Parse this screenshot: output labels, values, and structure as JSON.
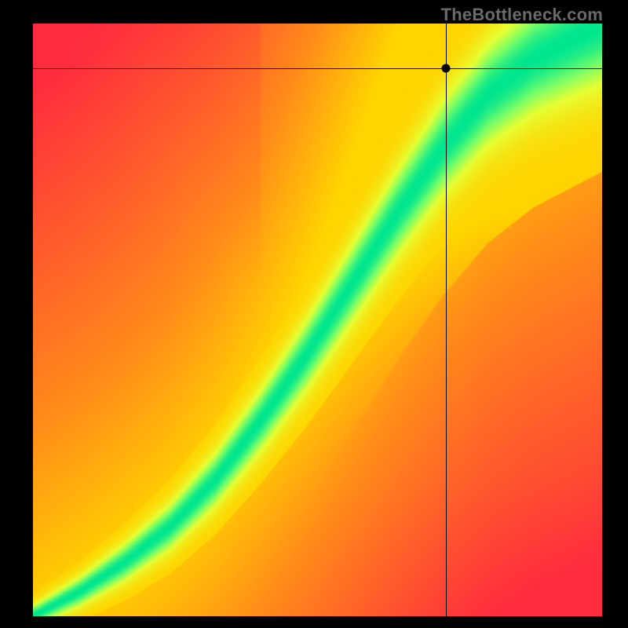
{
  "watermark": "TheBottleneck.com",
  "chart_data": {
    "type": "heatmap",
    "title": "",
    "xlabel": "",
    "ylabel": "",
    "xlim": [
      0,
      1
    ],
    "ylim": [
      0,
      1
    ],
    "gradient_stops": [
      {
        "t": 0.0,
        "color": "#ff2b3f"
      },
      {
        "t": 0.35,
        "color": "#ff8a1a"
      },
      {
        "t": 0.55,
        "color": "#ffd400"
      },
      {
        "t": 0.72,
        "color": "#e6ff33"
      },
      {
        "t": 0.85,
        "color": "#7dff66"
      },
      {
        "t": 1.0,
        "color": "#00e68f"
      }
    ],
    "ridge": [
      {
        "x": 0.0,
        "y": 0.0
      },
      {
        "x": 0.08,
        "y": 0.04
      },
      {
        "x": 0.16,
        "y": 0.09
      },
      {
        "x": 0.24,
        "y": 0.15
      },
      {
        "x": 0.32,
        "y": 0.23
      },
      {
        "x": 0.4,
        "y": 0.33
      },
      {
        "x": 0.48,
        "y": 0.44
      },
      {
        "x": 0.56,
        "y": 0.56
      },
      {
        "x": 0.64,
        "y": 0.68
      },
      {
        "x": 0.72,
        "y": 0.79
      },
      {
        "x": 0.8,
        "y": 0.88
      },
      {
        "x": 0.88,
        "y": 0.94
      },
      {
        "x": 1.0,
        "y": 1.0
      }
    ],
    "ridge_width_base": 0.018,
    "ridge_width_gain": 0.085,
    "corner_boost": {
      "top_left": 0.0,
      "top_right": 0.55,
      "bottom_left": 0.0,
      "bottom_right": 0.0
    },
    "marker": {
      "x": 0.725,
      "y": 0.925
    },
    "crosshair": {
      "x": 0.725,
      "y": 0.925
    }
  }
}
